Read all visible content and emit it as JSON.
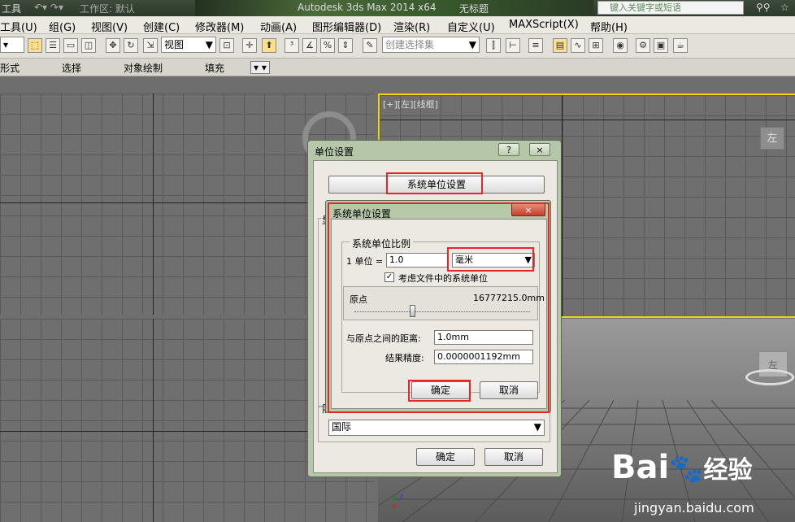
{
  "titlebar": {
    "tools_short": "工具",
    "workspace": "工作区: 默认",
    "app_title": "Autodesk 3ds Max  2014 x64",
    "doc_title": "无标题",
    "search_placeholder": "键入关键字或短语"
  },
  "menubar": {
    "items": [
      "工具(U)",
      "组(G)",
      "视图(V)",
      "创建(C)",
      "修改器(M)",
      "动画(A)",
      "图形编辑器(D)",
      "渲染(R)",
      "自定义(U)",
      "MAXScript(X)",
      "帮助(H)"
    ]
  },
  "toolbar": {
    "view_select": "视图",
    "selection_set": "创建选择集"
  },
  "ribbon": {
    "tabs": [
      "形式",
      "选择",
      "对象绘制",
      "填充"
    ]
  },
  "viewports": {
    "top_right_label": "[+][左][线框]",
    "viewcube_label": "左",
    "cube_label": "左"
  },
  "units_dialog": {
    "title": "单位设置",
    "help_button": "?",
    "close_button": "×",
    "system_units_button": "系统单位设置",
    "display_dropdown": "国际",
    "ok_button": "确定",
    "cancel_button": "取消",
    "group_letter_1": "显",
    "group_letter_2": "照"
  },
  "system_dialog": {
    "title": "系统单位设置",
    "close_button": "×",
    "scale_group": "系统单位比例",
    "unit_label": "1 单位 =",
    "unit_value": "1.0",
    "unit_select": "毫米",
    "consider_file_units": "考虑文件中的系统单位",
    "origin_label": "原点",
    "origin_value": "16777215.0mm",
    "slider_position_fraction": 0.33,
    "distance_label": "与原点之间的距离:",
    "distance_value": "1.0mm",
    "precision_label": "结果精度:",
    "precision_value": "0.0000001192mm",
    "ok_button": "确定",
    "cancel_button": "取消"
  },
  "watermark": {
    "brand": "Bai",
    "brand_suffix": "经验",
    "url": "jingyan.baidu.com"
  },
  "colors": {
    "highlight_red": "#e8232a",
    "active_viewport_yellow": "#f0d700"
  }
}
